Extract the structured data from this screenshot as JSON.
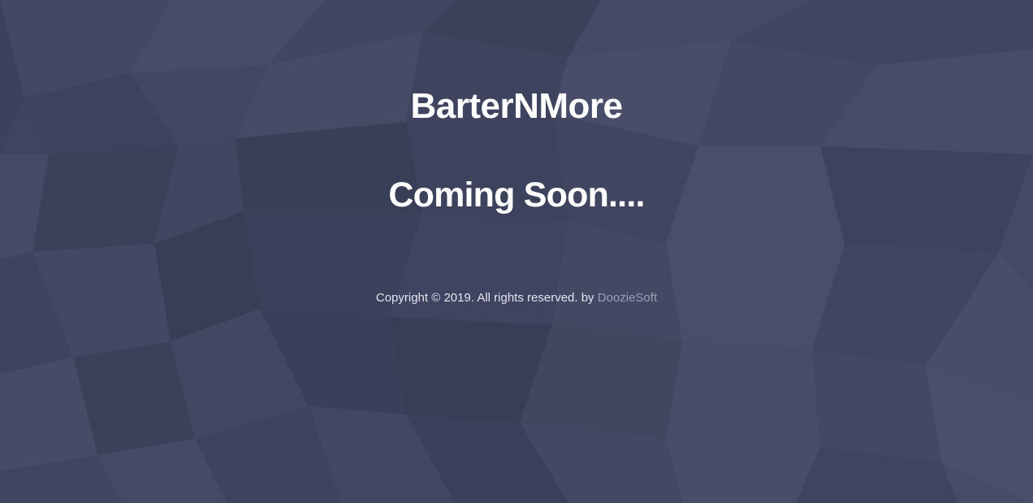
{
  "brand": {
    "name": "BarterNMore"
  },
  "main": {
    "headline": "Coming Soon...."
  },
  "footer": {
    "copyright": "Copyright © 2019. All rights reserved. by",
    "author_link": "DoozieSoft"
  },
  "colors": {
    "background": "#3f4560",
    "text": "#ffffff",
    "link": "#9aa0b6"
  }
}
